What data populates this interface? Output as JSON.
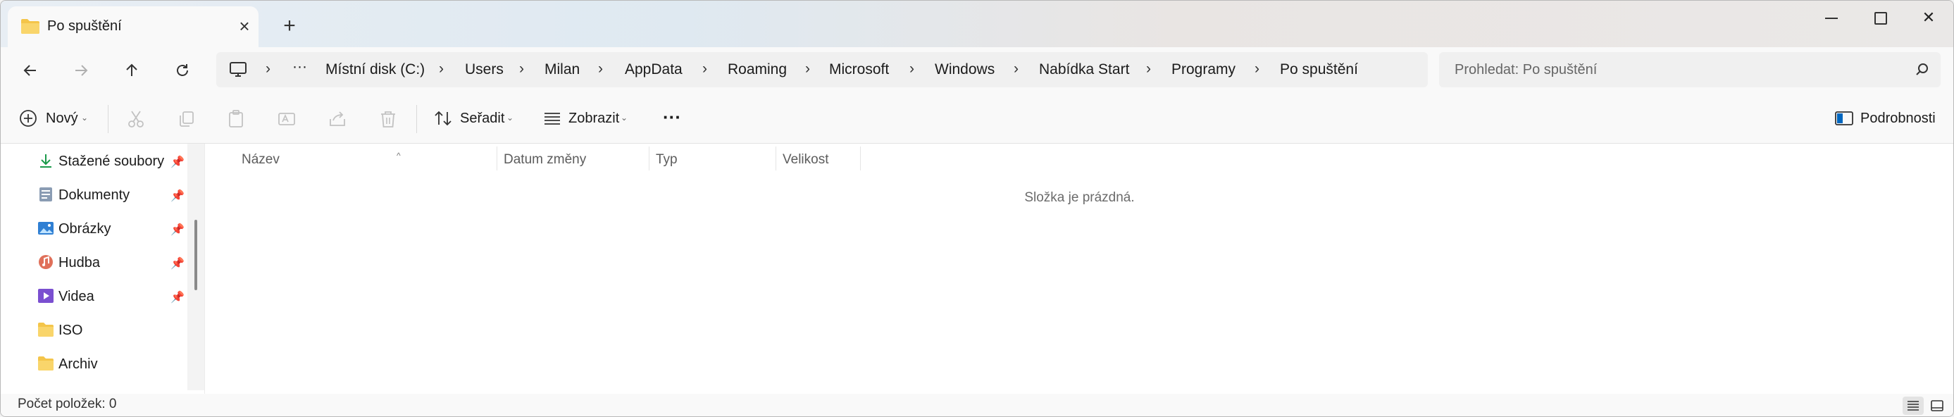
{
  "window": {
    "tab_title": "Po spuštění",
    "new_tab_symbol": "+",
    "close_tab_symbol": "×",
    "window_close_symbol": "✕"
  },
  "breadcrumb": {
    "overflow": "···",
    "items": [
      "Místní disk (C:)",
      "Users",
      "Milan",
      "AppData",
      "Roaming",
      "Microsoft",
      "Windows",
      "Nabídka Start",
      "Programy",
      "Po spuštění"
    ],
    "separator": "›"
  },
  "search": {
    "placeholder": "Prohledat: Po spuštění"
  },
  "toolbar": {
    "new_label": "Nový",
    "sort_label": "Seřadit",
    "view_label": "Zobrazit",
    "more_label": "···",
    "details_label": "Podrobnosti"
  },
  "nav": {
    "items": [
      {
        "label": "Stažené soubory",
        "icon": "download-icon",
        "pinned": true
      },
      {
        "label": "Dokumenty",
        "icon": "documents-icon",
        "pinned": true
      },
      {
        "label": "Obrázky",
        "icon": "pictures-icon",
        "pinned": true
      },
      {
        "label": "Hudba",
        "icon": "music-icon",
        "pinned": true
      },
      {
        "label": "Videa",
        "icon": "videos-icon",
        "pinned": true
      },
      {
        "label": "ISO",
        "icon": "folder-icon",
        "pinned": false
      },
      {
        "label": "Archiv",
        "icon": "folder-icon",
        "pinned": false
      }
    ]
  },
  "columns": {
    "name": "Název",
    "date": "Datum změny",
    "type": "Typ",
    "size": "Velikost"
  },
  "content": {
    "empty_message": "Složka je prázdná."
  },
  "status": {
    "item_count": "Počet položek: 0"
  },
  "colors": {
    "accent": "#0067c0",
    "folder": "#f4c54a",
    "download": "#1a9a4a"
  }
}
